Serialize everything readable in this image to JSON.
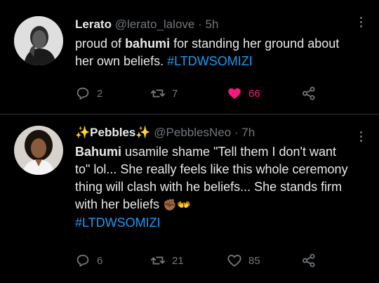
{
  "tweets": [
    {
      "name": "Lerato",
      "handle": "@lerato_lalove",
      "sep": "·",
      "time": "5h",
      "text": {
        "p1": "proud of ",
        "b1": "bahumi",
        "p2": " for standing her ground about her own beliefs. ",
        "tag": "#LTDWSOMIZI"
      },
      "replies": "2",
      "retweets": "7",
      "likes": "66",
      "liked": true,
      "accent_like": "#f91880"
    },
    {
      "name_prefix_icon": "sparkles-emoji",
      "name": "✨Pebbles✨",
      "handle": "@PebblesNeo",
      "sep": "·",
      "time": "7h",
      "text": {
        "b1": "Bahumi",
        "p1": " usamile shame \"Tell them I don't want to\" lol... She really feels like this whole ceremony thing will clash with he beliefs... She stands firm with her beliefs ",
        "emoji1": "✊🏾",
        "emoji2": "👐",
        "tag": "#LTDWSOMIZI"
      },
      "replies": "6",
      "retweets": "21",
      "likes": "85",
      "liked": false
    }
  ],
  "colors": {
    "background": "#000000",
    "link": "#1d9bf0",
    "muted": "#71767b",
    "divider": "#2f3336"
  }
}
